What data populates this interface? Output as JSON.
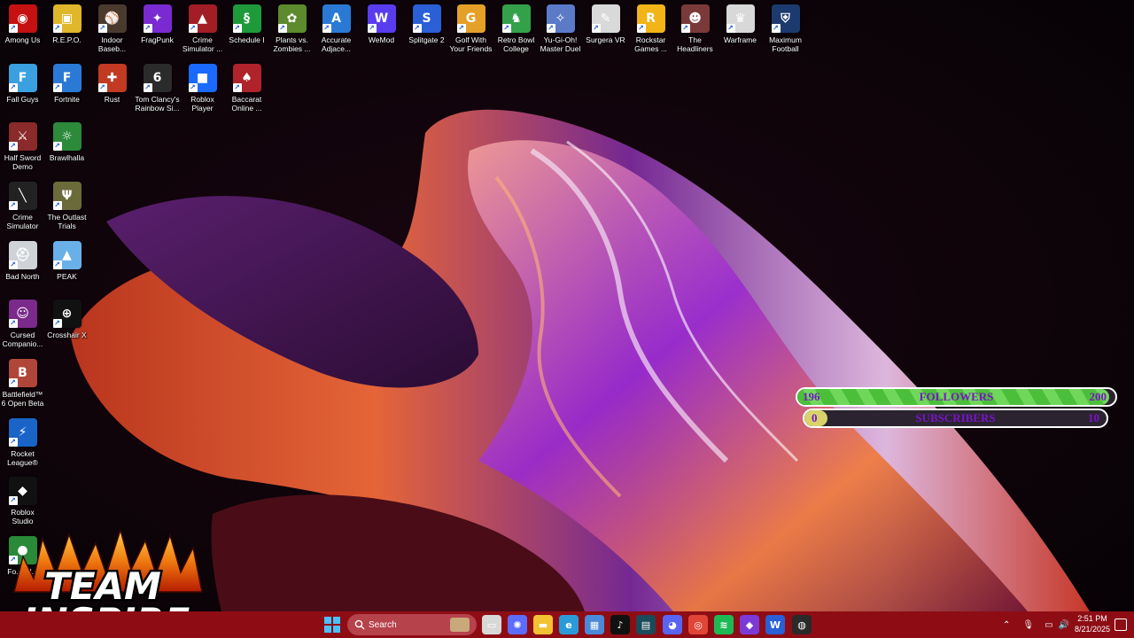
{
  "desktop": {
    "icons": [
      {
        "label": "Among Us",
        "color": "#c51111",
        "glyph": "◉"
      },
      {
        "label": "R.E.P.O.",
        "color": "#e0b62a",
        "glyph": "▣"
      },
      {
        "label": "Indoor Baseb...",
        "color": "#4a3a2e",
        "glyph": "⚾"
      },
      {
        "label": "FragPunk",
        "color": "#7a2ad0",
        "glyph": "✦"
      },
      {
        "label": "Crime Simulator ...",
        "color": "#a21d24",
        "glyph": "▲"
      },
      {
        "label": "Schedule I",
        "color": "#1e9a3b",
        "glyph": "§"
      },
      {
        "label": "Plants vs. Zombies ...",
        "color": "#5c8a2d",
        "glyph": "✿"
      },
      {
        "label": "Accurate Adjace...",
        "color": "#2a7ad5",
        "glyph": "A"
      },
      {
        "label": "WeMod",
        "color": "#5a3cf0",
        "glyph": "W"
      },
      {
        "label": "Splitgate 2",
        "color": "#2a5fd5",
        "glyph": "S"
      },
      {
        "label": "Golf With Your Friends",
        "color": "#e5a028",
        "glyph": "G"
      },
      {
        "label": "Retro Bowl College",
        "color": "#33a14a",
        "glyph": "♞"
      },
      {
        "label": "Yu-Gi-Oh! Master Duel",
        "color": "#5b7bc8",
        "glyph": "✧"
      },
      {
        "label": "Surgera VR",
        "color": "#d9d9d9",
        "glyph": "✎"
      },
      {
        "label": "Rockstar Games ...",
        "color": "#f2b416",
        "glyph": "R"
      },
      {
        "label": "The Headliners",
        "color": "#7b3a3a",
        "glyph": "☻"
      },
      {
        "label": "Warframe",
        "color": "#d8d8d8",
        "glyph": "♛"
      },
      {
        "label": "Maximum Football",
        "color": "#1c3a6e",
        "glyph": "⛨"
      },
      {
        "label": "Fall Guys",
        "color": "#3aa0e0",
        "glyph": "F"
      },
      {
        "label": "Fortnite",
        "color": "#2a7ad5",
        "glyph": "F"
      },
      {
        "label": "Rust",
        "color": "#c23a22",
        "glyph": "✚"
      },
      {
        "label": "Tom Clancy's Rainbow Si...",
        "color": "#2b2b2b",
        "glyph": "6"
      },
      {
        "label": "Roblox Player",
        "color": "#1a6aff",
        "glyph": "■"
      },
      {
        "label": "Baccarat Online ...",
        "color": "#b0232a",
        "glyph": "♠"
      },
      {
        "label": "Half Sword Demo",
        "color": "#8a2a2a",
        "glyph": "⚔"
      },
      {
        "label": "Brawlhalla",
        "color": "#2c8a3a",
        "glyph": "☼"
      },
      {
        "label": "Crime Simulator",
        "color": "#222222",
        "glyph": "╲"
      },
      {
        "label": "The Outlast Trials",
        "color": "#6b6a3a",
        "glyph": "Ψ"
      },
      {
        "label": "Bad North",
        "color": "#cfd3d8",
        "glyph": "⛑"
      },
      {
        "label": "PEAK",
        "color": "#6ab0e8",
        "glyph": "▲"
      },
      {
        "label": "Cursed Companio...",
        "color": "#7a2a8a",
        "glyph": "☺"
      },
      {
        "label": "Crosshair X",
        "color": "#111111",
        "glyph": "⊕"
      },
      {
        "label": "Battlefield™ 6 Open Beta",
        "color": "#b0463a",
        "glyph": "B"
      },
      {
        "label": "Rocket League®",
        "color": "#1a64c8",
        "glyph": "⚡"
      },
      {
        "label": "Roblox Studio",
        "color": "#111111",
        "glyph": "◆"
      },
      {
        "label": "Fo... Cl...",
        "color": "#2a8a3a",
        "glyph": "●"
      }
    ]
  },
  "overlay": {
    "followers": {
      "current": "196",
      "label": "FOLLOWERS",
      "goal": "200",
      "progress": 0.98
    },
    "subscribers": {
      "current": "0",
      "label": "SUBSCRIBERS",
      "goal": "10",
      "progress": 0.0
    }
  },
  "logo": {
    "line1": "TEAM",
    "line2": "INSPIRE"
  },
  "taskbar": {
    "search_label": "Search",
    "apps": [
      {
        "name": "task-view",
        "color": "#d8d8d8",
        "glyph": "▭"
      },
      {
        "name": "copilot",
        "color": "#5c6cff",
        "glyph": "✺"
      },
      {
        "name": "file-explorer",
        "color": "#f2c232",
        "glyph": "▬"
      },
      {
        "name": "edge",
        "color": "#2a9bd8",
        "glyph": "e"
      },
      {
        "name": "store",
        "color": "#4a8ad8",
        "glyph": "▦"
      },
      {
        "name": "tiktok",
        "color": "#111111",
        "glyph": "♪"
      },
      {
        "name": "app-dark",
        "color": "#1b4a5a",
        "glyph": "▤"
      },
      {
        "name": "discord",
        "color": "#5865f2",
        "glyph": "◕"
      },
      {
        "name": "chrome",
        "color": "#e04535",
        "glyph": "◎"
      },
      {
        "name": "spotify",
        "color": "#1db954",
        "glyph": "≋"
      },
      {
        "name": "app-purple",
        "color": "#7b3ad8",
        "glyph": "◆"
      },
      {
        "name": "app-blue",
        "color": "#2a5fd5",
        "glyph": "W"
      },
      {
        "name": "obs",
        "color": "#2a2a2a",
        "glyph": "◍"
      }
    ],
    "clock": {
      "time": "2:51 PM",
      "date": "8/21/2025"
    }
  },
  "colors": {
    "taskbar": "#8e0d15",
    "followers_fill": "#4cbf3a",
    "subscribers_fill": "#d8d36a",
    "overlay_text": "#7a14c8"
  }
}
